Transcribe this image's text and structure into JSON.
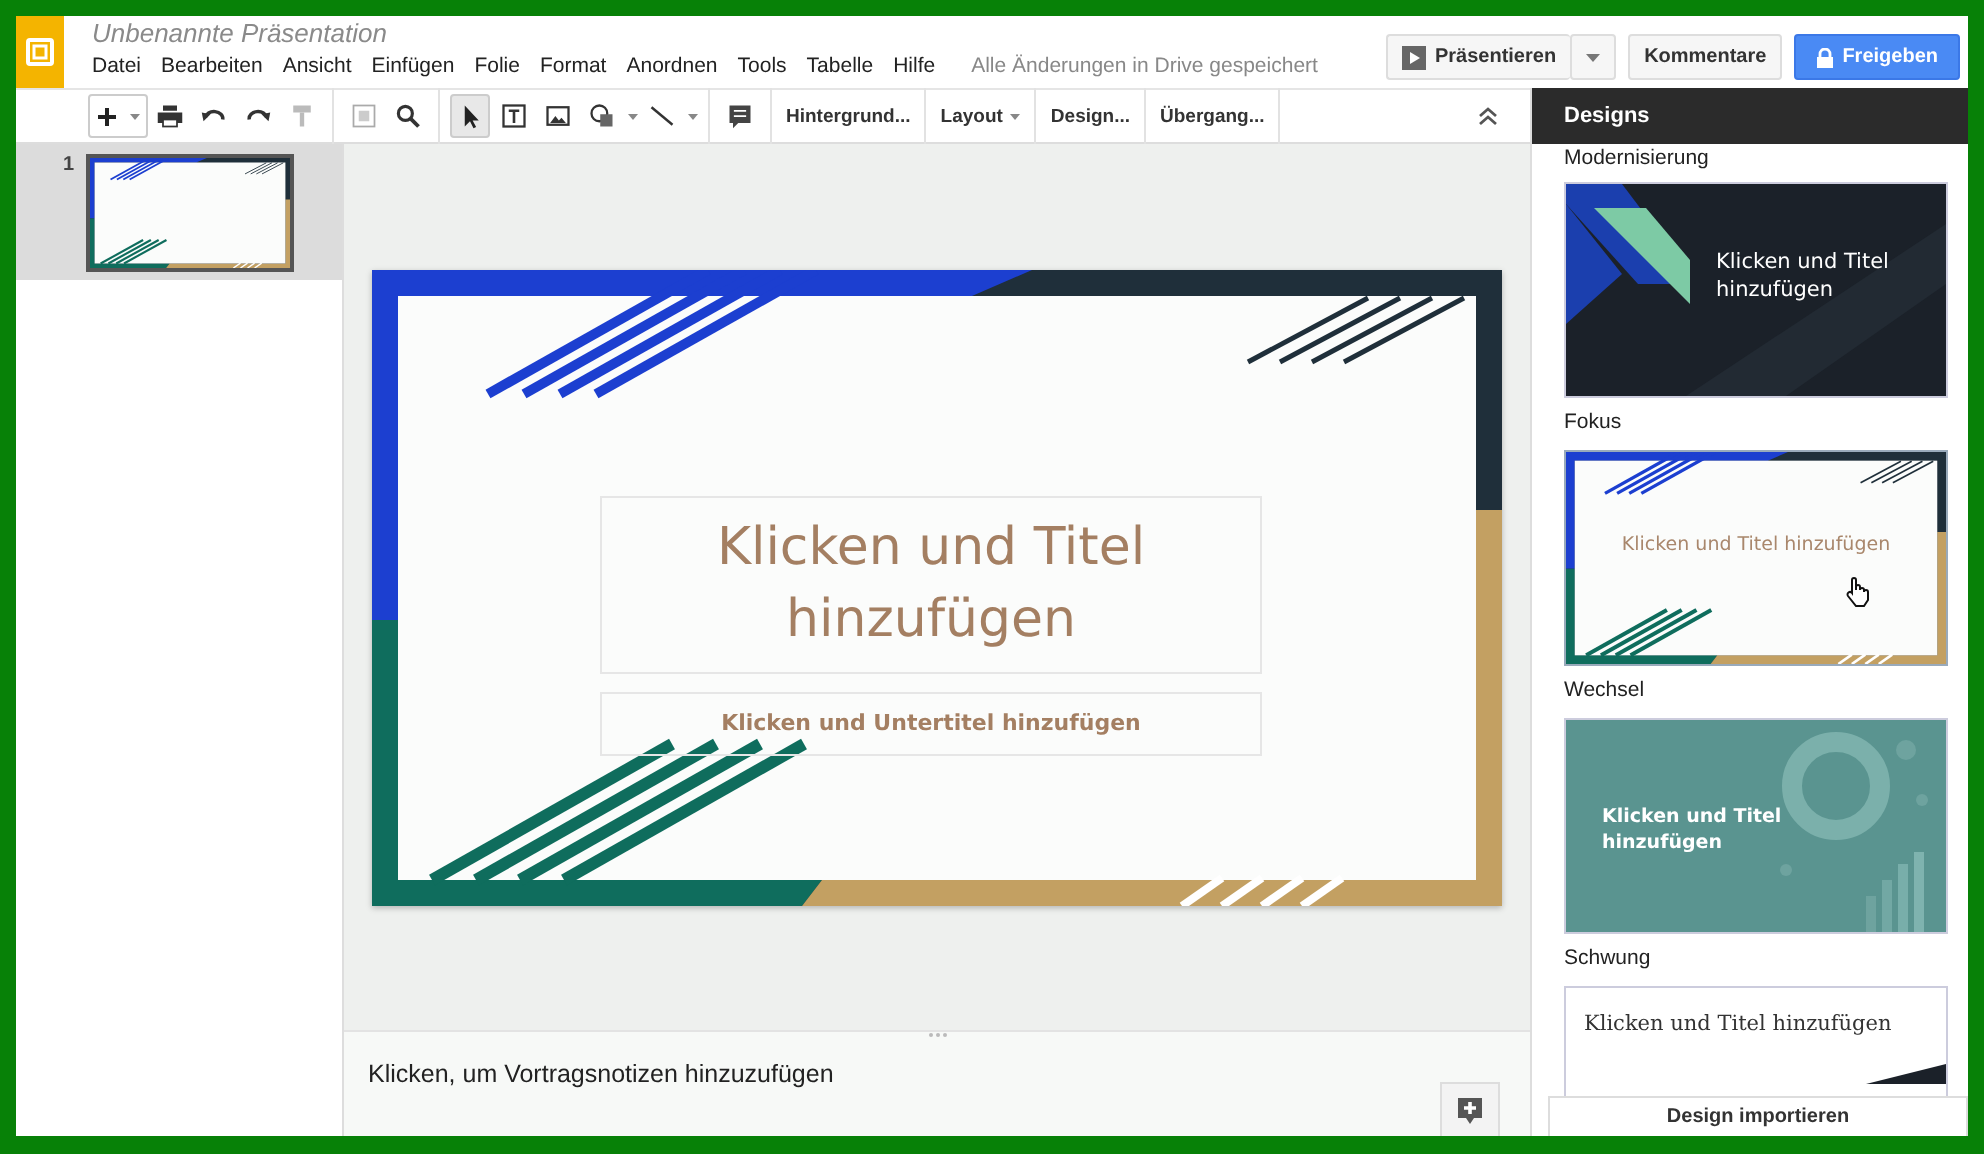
{
  "header": {
    "title": "Unbenannte Präsentation",
    "menus": [
      "Datei",
      "Bearbeiten",
      "Ansicht",
      "Einfügen",
      "Folie",
      "Format",
      "Anordnen",
      "Tools",
      "Tabelle",
      "Hilfe"
    ],
    "save_status": "Alle Änderungen in Drive gespeichert",
    "present": "Präsentieren",
    "comments": "Kommentare",
    "share": "Freigeben"
  },
  "toolbar": {
    "tools": [
      {
        "kind": "cursor",
        "selected": true
      },
      {
        "kind": "textbox",
        "selected": false
      },
      {
        "kind": "image",
        "selected": false
      },
      {
        "kind": "shape",
        "selected": false
      },
      {
        "kind": "line",
        "selected": false
      }
    ],
    "text_buttons": [
      {
        "label": "Hintergrund...",
        "dropdown": false
      },
      {
        "label": "Layout",
        "dropdown": true
      },
      {
        "label": "Design...",
        "dropdown": false
      },
      {
        "label": "Übergang...",
        "dropdown": false
      }
    ]
  },
  "filmstrip": [
    {
      "number": "1",
      "selected": true
    }
  ],
  "slide": {
    "title": "Klicken und Titel hinzufügen",
    "subtitle": "Klicken und Untertitel hinzufügen"
  },
  "notes": {
    "placeholder": "Klicken, um Vortragsnotizen hinzuzufügen"
  },
  "designs": {
    "title": "Designs",
    "themes": [
      {
        "kind": "cut",
        "name": "Modernisierung"
      },
      {
        "kind": "dark",
        "preview_title": "Klicken und Titel hinzufügen",
        "name": "Fokus"
      },
      {
        "kind": "focus",
        "preview_title": "Klicken und Titel hinzufügen",
        "name": "Wechsel",
        "hovered": true
      },
      {
        "kind": "teal",
        "preview_title": "Klicken und Titel hinzufügen",
        "name": "Schwung"
      },
      {
        "kind": "serif",
        "preview_title": "Klicken und Titel hinzufügen"
      }
    ],
    "import_button": "Design importieren"
  }
}
